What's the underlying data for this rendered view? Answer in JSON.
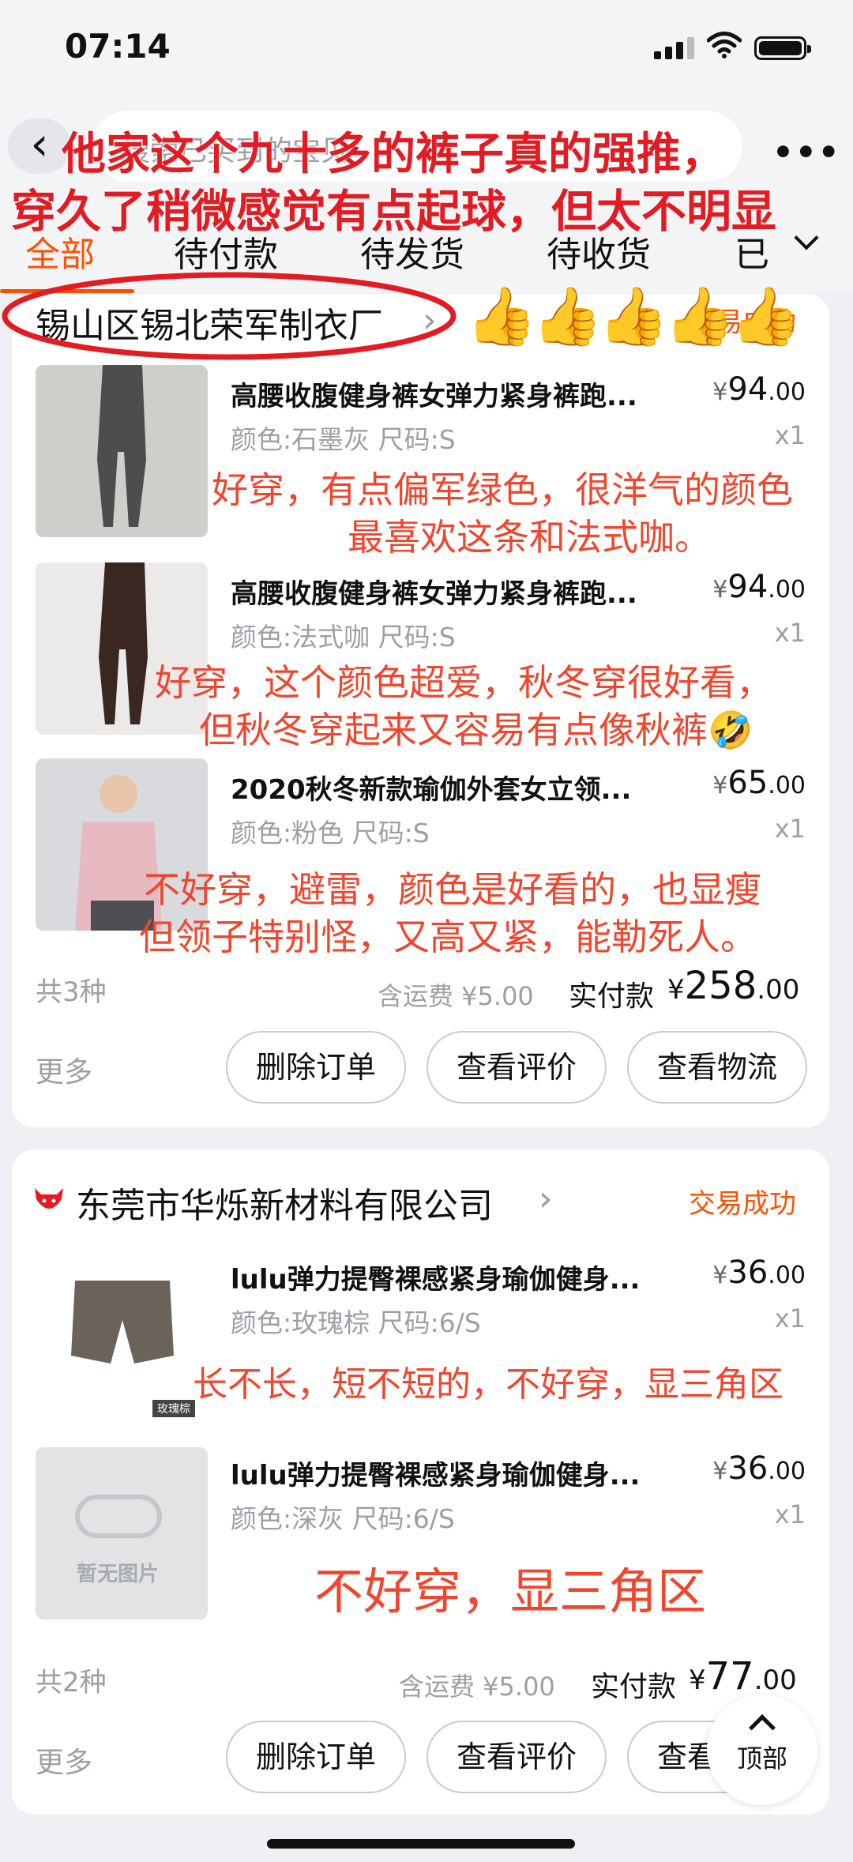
{
  "status_bar": {
    "time": "07:14"
  },
  "header": {
    "search_placeholder": "搜索已买到的宝贝",
    "more": "•••",
    "tabs": [
      "全部",
      "待付款",
      "待发货",
      "待收货",
      "已"
    ]
  },
  "overlay": {
    "line1": "他家这个九十多的裤子真的强推，",
    "line2": "穿久了稍微感觉有点起球，但太不明显",
    "thumbs": "👍👍👍👍👍"
  },
  "orders": [
    {
      "shop": "锡山区锡北荣军制衣厂",
      "status": "交易成功",
      "items": [
        {
          "title": "高腰收腹健身裤女弹力紧身裤跑...",
          "sku": "颜色:石墨灰 尺码:S",
          "price_int": "94",
          "price_dec": ".00",
          "qty": "x1",
          "note": [
            "好穿，有点偏军绿色，很洋气的颜色",
            "最喜欢这条和法式咖。"
          ]
        },
        {
          "title": "高腰收腹健身裤女弹力紧身裤跑...",
          "sku": "颜色:法式咖 尺码:S",
          "price_int": "94",
          "price_dec": ".00",
          "qty": "x1",
          "note": [
            "好穿，这个颜色超爱，秋冬穿很好看，",
            "但秋冬穿起来又容易有点像秋裤🤣"
          ]
        },
        {
          "title": "2020秋冬新款瑜伽外套女立领...",
          "sku": "颜色:粉色 尺码:S",
          "price_int": "65",
          "price_dec": ".00",
          "qty": "x1",
          "note": [
            "不好穿，避雷，颜色是好看的，也显瘦",
            "但领子特别怪，又高又紧，能勒死人。"
          ]
        }
      ],
      "count": "共3种",
      "shipping": "含运费 ¥5.00",
      "paid_label": "实付款",
      "paid_int": "258",
      "paid_dec": ".00",
      "more": "更多",
      "buttons": [
        "删除订单",
        "查看评价",
        "查看物流"
      ]
    },
    {
      "shop": "东莞市华烁新材料有限公司",
      "status": "交易成功",
      "items": [
        {
          "title": "lulu弹力提臀裸感紧身瑜伽健身...",
          "sku": "颜色:玫瑰棕 尺码:6/S",
          "price_int": "36",
          "price_dec": ".00",
          "qty": "x1",
          "tag": "玫瑰棕",
          "note": [
            "长不长，短不短的，不好穿，显三角区"
          ]
        },
        {
          "title": "lulu弹力提臀裸感紧身瑜伽健身...",
          "sku": "颜色:深灰 尺码:6/S",
          "price_int": "36",
          "price_dec": ".00",
          "qty": "x1",
          "noimg": "暂无图片",
          "note": [
            "不好穿，显三角区"
          ]
        }
      ],
      "count": "共2种",
      "shipping": "含运费 ¥5.00",
      "paid_label": "实付款",
      "paid_int": "77",
      "paid_dec": ".00",
      "more": "更多",
      "buttons": [
        "删除订单",
        "查看评价",
        "查看物流"
      ]
    }
  ],
  "top_button": {
    "label": "顶部"
  },
  "currency": "¥",
  "colors": {
    "accent": "#ff5000",
    "overlay_red": "#e31b23",
    "note_red": "#f0462e"
  }
}
